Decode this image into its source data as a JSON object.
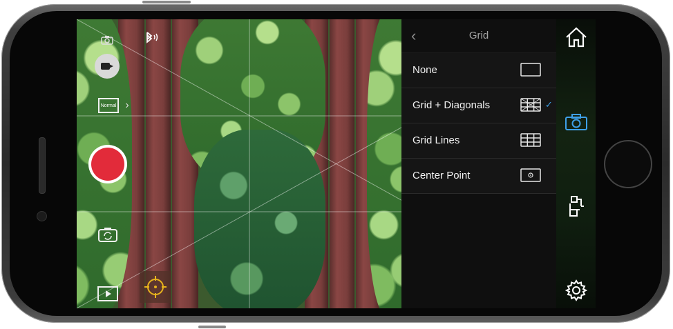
{
  "panel": {
    "title": "Grid",
    "options": [
      {
        "label": "None",
        "icon": "no-grid-icon",
        "selected": false
      },
      {
        "label": "Grid + Diagonals",
        "icon": "grid-diagonals-icon",
        "selected": true
      },
      {
        "label": "Grid Lines",
        "icon": "grid-lines-icon",
        "selected": false
      },
      {
        "label": "Center Point",
        "icon": "center-point-icon",
        "selected": false
      }
    ]
  },
  "camera": {
    "format_label": "Normal",
    "record_color": "#e22b3a",
    "focus_color": "#e8b41c"
  },
  "nav": {
    "active_color": "#3ea0e8",
    "items": [
      "home-icon",
      "camera-icon",
      "gimbal-icon",
      "settings-icon"
    ]
  }
}
